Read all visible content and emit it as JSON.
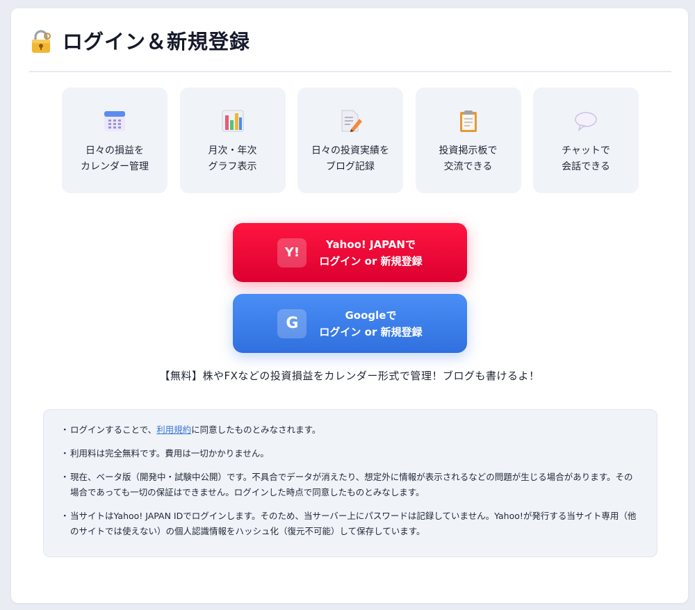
{
  "title": "ログイン＆新規登録",
  "features": [
    {
      "icon": "calendar-icon",
      "label": "日々の損益を\nカレンダー管理"
    },
    {
      "icon": "bar-chart-icon",
      "label": "月次・年次\nグラフ表示"
    },
    {
      "icon": "memo-icon",
      "label": "日々の投資実績を\nブログ記録"
    },
    {
      "icon": "clipboard-icon",
      "label": "投資掲示板で\n交流できる"
    },
    {
      "icon": "speech-bubble-icon",
      "label": "チャットで\n会話できる"
    }
  ],
  "buttons": {
    "yahoo": {
      "badge": "Y!",
      "label": "Yahoo! JAPANで\nログイン or 新規登録",
      "color": "#ff0033"
    },
    "google": {
      "badge": "G",
      "label": "Googleで\nログイン or 新規登録",
      "color": "#4285f4"
    }
  },
  "tagline": "【無料】株やFXなどの投資損益をカレンダー形式で管理！ブログも書けるよ！",
  "notes": {
    "note1_before": "ログインすることで、",
    "note1_link": "利用規約",
    "note1_after": "に同意したものとみなされます。",
    "note2": "利用料は完全無料です。費用は一切かかりません。",
    "note3": "現在、ベータ版（開発中・試験中公開）です。不具合でデータが消えたり、想定外に情報が表示されるなどの問題が生じる場合があります。その場合であっても一切の保証はできません。ログインした時点で同意したものとみなします。",
    "note4": "当サイトはYahoo! JAPAN IDでログインします。そのため、当サーバー上にパスワードは記録していません。Yahoo!が発行する当サイト専用（他のサイトでは使えない）の個人認識情報をハッシュ化（復元不可能）して保存しています。",
    "bullet": "・"
  }
}
